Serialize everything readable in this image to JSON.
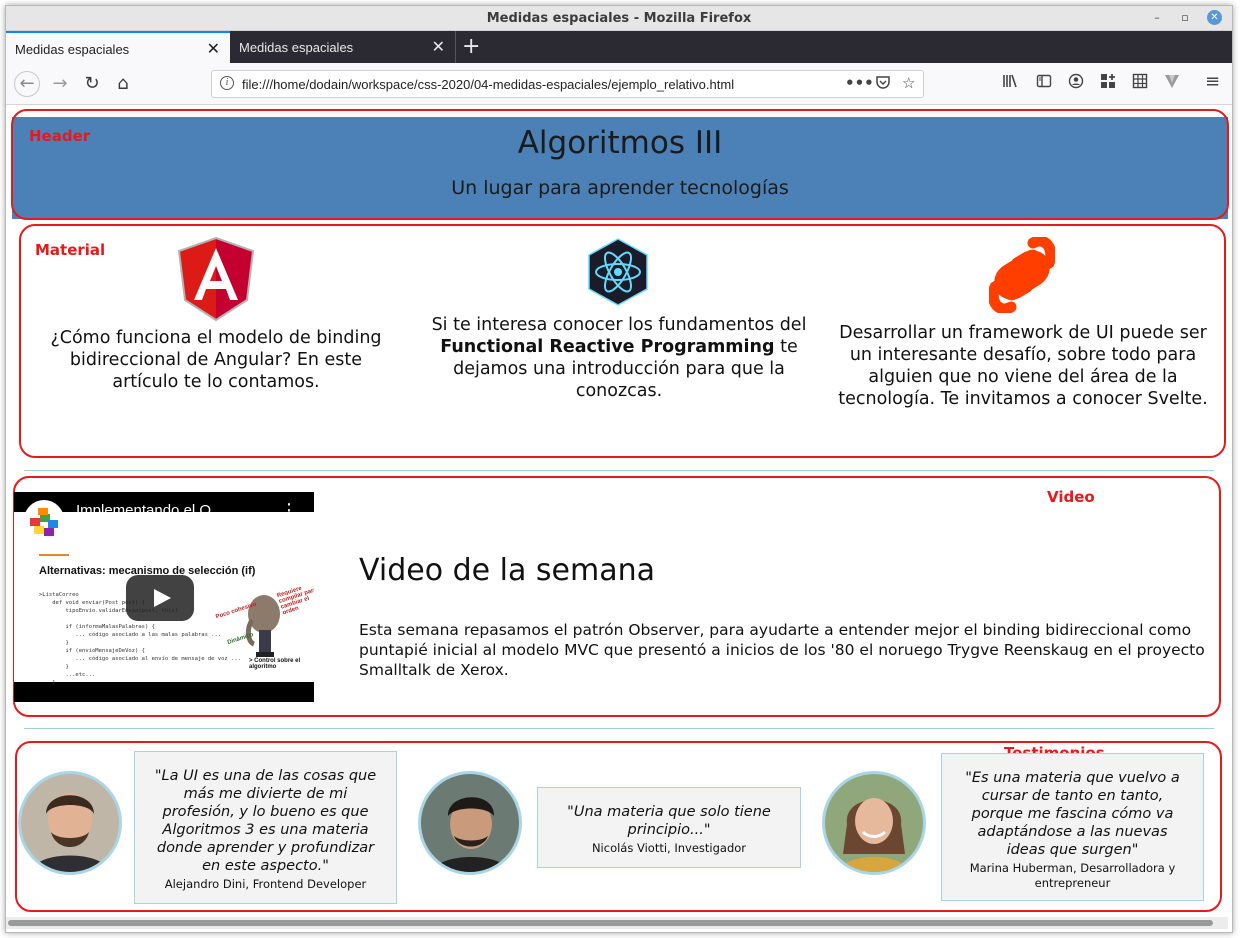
{
  "window": {
    "title": "Medidas espaciales - Mozilla Firefox",
    "controls": {
      "minimize": "–",
      "maximize": "▫",
      "close": "✕"
    }
  },
  "tabs": [
    {
      "label": "Medidas espaciales",
      "active": true
    },
    {
      "label": "Medidas espaciales",
      "active": false
    }
  ],
  "new_tab": "+",
  "nav": {
    "back_icon": "←",
    "forward_icon": "→",
    "reload_icon": "↻",
    "home_icon": "⌂",
    "url": "file:///home/dodain/workspace/css-2020/04-medidas-espaciales/ejemplo_relativo.html",
    "info_icon": "i",
    "more_icon": "•••",
    "pocket_icon": "◡",
    "star_icon": "☆",
    "library_icon": "|||\\",
    "sidebar_icon": "▥",
    "account_icon": "◉",
    "extension_icon": "▚",
    "grid_icon": "▦",
    "vpn_icon": "▼",
    "menu_icon": "≡"
  },
  "page": {
    "header": {
      "label": "Header",
      "title": "Algoritmos III",
      "subtitle": "Un lugar para aprender tecnologías"
    },
    "material": {
      "label": "Material",
      "items": [
        {
          "icon": "angular-logo",
          "text": "¿Cómo funciona el modelo de binding bidireccional de Angular? En este artículo te lo contamos."
        },
        {
          "icon": "react-logo",
          "text_before": "Si te interesa conocer los fundamentos del",
          "text_bold": "Functional Reactive Programming",
          "text_after": "te dejamos una introducción para que la conozcas."
        },
        {
          "icon": "svelte-logo",
          "text": "Desarrollar un framework de UI puede ser un interesante desafío, sobre todo para alguien que no viene del área de la tecnología. Te invitamos a conocer Svelte."
        }
      ]
    },
    "video": {
      "label": "Video",
      "player_title": "Implementando el O...",
      "menu_icon": "⋮",
      "slide_heading": "Alternativas: mecanismo de selección (if)",
      "slide_code": ">ListaCorreo\n    def void enviar(Post post) {\n        tipoEnvio.validarEnvio(post, this)\n\n        if (informaMalasPalabras) {\n           ... código asociado a las malas palabras ...\n        }\n        if (envioMensajeDeVoz) {\n           ... código asociado al envío de mensaje de voz ...\n        }\n        ...etc...\n    }",
      "slide_notes": [
        "Requiere compilar para cambiar el orden",
        "Poco cohesivo",
        "Dinámico",
        "> Control sobre el algoritmo"
      ],
      "heading": "Video de la semana",
      "description": "Esta semana repasamos el patrón Observer, para ayudarte a entender mejor el binding bidireccional como puntapié inicial al modelo MVC que presentó a inicios de los '80 el noruego Trygve Reenskaug en el proyecto Smalltalk de Xerox."
    },
    "testimonials": {
      "label": "Testimonios",
      "items": [
        {
          "quote": "\"La UI es una de las cosas que más me divierte de mi profesión, y lo bueno es que Algoritmos 3 es una materia donde aprender y profundizar en este aspecto.\"",
          "author": "Alejandro Dini, Frontend Developer"
        },
        {
          "quote": "\"Una materia que solo tiene principio...\"",
          "author": "Nicolás Viotti, Investigador"
        },
        {
          "quote": "\"Es una materia que vuelvo a cursar de tanto en tanto, porque me fascina cómo va adaptándose a las nuevas ideas que surgen\"",
          "author": "Marina Huberman, Desarrolladora y entrepreneur"
        }
      ]
    }
  },
  "colors": {
    "header_bg": "#4b81b6",
    "annotation_red": "#e51a1a",
    "separator": "#9fd0dc",
    "angular_red": "#dd1b16",
    "react_cyan": "#61dafb",
    "svelte_orange": "#ff3e00"
  }
}
